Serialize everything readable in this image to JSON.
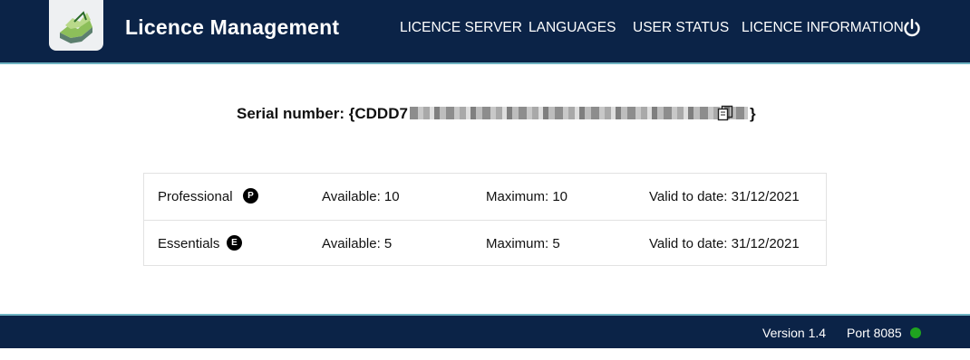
{
  "header": {
    "app_title": "Licence Management",
    "logo_icon": "map-logo-icon",
    "nav": [
      {
        "label": "LICENCE SERVER"
      },
      {
        "label": "LANGUAGES"
      },
      {
        "label": "USER STATUS"
      },
      {
        "label": "LICENCE INFORMATION"
      }
    ],
    "power_icon": "power-icon"
  },
  "serial": {
    "label": "Serial number: {CDDD7",
    "suffix": "}"
  },
  "licences": [
    {
      "name": "Professional",
      "badge": "P",
      "available": "Available: 10",
      "maximum": "Maximum: 10",
      "valid": "Valid to date: 31/12/2021"
    },
    {
      "name": "Essentials",
      "badge": "E",
      "available": "Available: 5",
      "maximum": "Maximum: 5",
      "valid": "Valid to date: 31/12/2021"
    }
  ],
  "footer": {
    "version": "Version 1.4",
    "port": "Port 8085",
    "status_color": "#1fa31f"
  },
  "colors": {
    "header_bg": "#0b2347",
    "accent_line": "#6fb3c2"
  }
}
